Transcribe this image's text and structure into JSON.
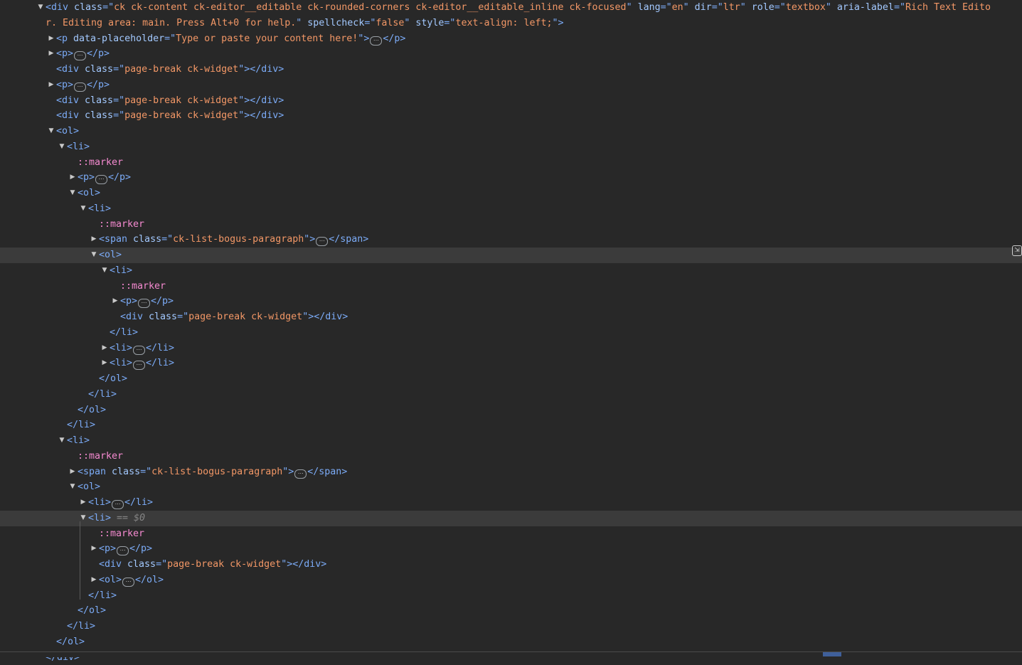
{
  "rows": [
    {
      "indent": 0,
      "toggle": "open",
      "parts": [
        [
          "t",
          "<div "
        ],
        [
          "an",
          "class"
        ],
        [
          "t",
          "=\""
        ],
        [
          "av",
          "ck ck-content ck-editor__editable ck-rounded-corners ck-editor__editable_inline ck-focused"
        ],
        [
          "t",
          "\" "
        ],
        [
          "an",
          "lang"
        ],
        [
          "t",
          "=\""
        ],
        [
          "av",
          "en"
        ],
        [
          "t",
          "\" "
        ],
        [
          "an",
          "dir"
        ],
        [
          "t",
          "=\""
        ],
        [
          "av",
          "ltr"
        ],
        [
          "t",
          "\" "
        ],
        [
          "an",
          "role"
        ],
        [
          "t",
          "=\""
        ],
        [
          "av",
          "textbox"
        ],
        [
          "t",
          "\" "
        ],
        [
          "an",
          "aria-label"
        ],
        [
          "t",
          "=\""
        ],
        [
          "av",
          "Rich Text Edito"
        ]
      ]
    },
    {
      "indent": 0,
      "parts": [
        [
          "av",
          "r. Editing area: main. Press Alt+0 for help."
        ],
        [
          "t",
          "\" "
        ],
        [
          "an",
          "spellcheck"
        ],
        [
          "t",
          "=\""
        ],
        [
          "av",
          "false"
        ],
        [
          "t",
          "\" "
        ],
        [
          "an",
          "style"
        ],
        [
          "t",
          "=\""
        ],
        [
          "av",
          "text-align: left;"
        ],
        [
          "t",
          "\">"
        ]
      ]
    },
    {
      "indent": 1,
      "toggle": "closed",
      "parts": [
        [
          "t",
          "<p "
        ],
        [
          "an",
          "data-placeholder"
        ],
        [
          "t",
          "=\""
        ],
        [
          "av",
          "Type or paste your content here!"
        ],
        [
          "t",
          "\">"
        ],
        [
          "ell",
          "⋯"
        ],
        [
          "t",
          "</p>"
        ]
      ]
    },
    {
      "indent": 1,
      "toggle": "closed",
      "parts": [
        [
          "t",
          "<p>"
        ],
        [
          "ell",
          "⋯"
        ],
        [
          "t",
          "</p>"
        ]
      ]
    },
    {
      "indent": 1,
      "parts": [
        [
          "t",
          "<div "
        ],
        [
          "an",
          "class"
        ],
        [
          "t",
          "=\""
        ],
        [
          "av",
          "page-break ck-widget"
        ],
        [
          "t",
          "\"></div>"
        ]
      ]
    },
    {
      "indent": 1,
      "toggle": "closed",
      "parts": [
        [
          "t",
          "<p>"
        ],
        [
          "ell",
          "⋯"
        ],
        [
          "t",
          "</p>"
        ]
      ]
    },
    {
      "indent": 1,
      "parts": [
        [
          "t",
          "<div "
        ],
        [
          "an",
          "class"
        ],
        [
          "t",
          "=\""
        ],
        [
          "av",
          "page-break ck-widget"
        ],
        [
          "t",
          "\"></div>"
        ]
      ]
    },
    {
      "indent": 1,
      "parts": [
        [
          "t",
          "<div "
        ],
        [
          "an",
          "class"
        ],
        [
          "t",
          "=\""
        ],
        [
          "av",
          "page-break ck-widget"
        ],
        [
          "t",
          "\"></div>"
        ]
      ]
    },
    {
      "indent": 1,
      "toggle": "open",
      "parts": [
        [
          "t",
          "<ol>"
        ]
      ]
    },
    {
      "indent": 2,
      "toggle": "open",
      "parts": [
        [
          "t",
          "<li>"
        ]
      ]
    },
    {
      "indent": 3,
      "parts": [
        [
          "ps",
          "::marker"
        ]
      ]
    },
    {
      "indent": 3,
      "toggle": "closed",
      "parts": [
        [
          "t",
          "<p>"
        ],
        [
          "ell",
          "⋯"
        ],
        [
          "t",
          "</p>"
        ]
      ]
    },
    {
      "indent": 3,
      "toggle": "open",
      "parts": [
        [
          "t",
          "<ol>"
        ]
      ]
    },
    {
      "indent": 4,
      "toggle": "open",
      "parts": [
        [
          "t",
          "<li>"
        ]
      ]
    },
    {
      "indent": 5,
      "parts": [
        [
          "ps",
          "::marker"
        ]
      ]
    },
    {
      "indent": 5,
      "toggle": "closed",
      "parts": [
        [
          "t",
          "<span "
        ],
        [
          "an",
          "class"
        ],
        [
          "t",
          "=\""
        ],
        [
          "av",
          "ck-list-bogus-paragraph"
        ],
        [
          "t",
          "\">"
        ],
        [
          "ell",
          "⋯"
        ],
        [
          "t",
          "</span>"
        ]
      ]
    },
    {
      "indent": 5,
      "toggle": "open",
      "selected": true,
      "parts": [
        [
          "t",
          "<ol>"
        ]
      ]
    },
    {
      "indent": 6,
      "toggle": "open",
      "parts": [
        [
          "t",
          "<li>"
        ]
      ]
    },
    {
      "indent": 7,
      "parts": [
        [
          "ps",
          "::marker"
        ]
      ]
    },
    {
      "indent": 7,
      "toggle": "closed",
      "parts": [
        [
          "t",
          "<p>"
        ],
        [
          "ell",
          "⋯"
        ],
        [
          "t",
          "</p>"
        ]
      ]
    },
    {
      "indent": 7,
      "parts": [
        [
          "t",
          "<div "
        ],
        [
          "an",
          "class"
        ],
        [
          "t",
          "=\""
        ],
        [
          "av",
          "page-break ck-widget"
        ],
        [
          "t",
          "\"></div>"
        ]
      ]
    },
    {
      "indent": 6,
      "parts": [
        [
          "t",
          "</li>"
        ]
      ]
    },
    {
      "indent": 6,
      "toggle": "closed",
      "parts": [
        [
          "t",
          "<li>"
        ],
        [
          "ell",
          "⋯"
        ],
        [
          "t",
          "</li>"
        ]
      ]
    },
    {
      "indent": 6,
      "toggle": "closed",
      "parts": [
        [
          "t",
          "<li>"
        ],
        [
          "ell",
          "⋯"
        ],
        [
          "t",
          "</li>"
        ]
      ]
    },
    {
      "indent": 5,
      "parts": [
        [
          "t",
          "</ol>"
        ]
      ]
    },
    {
      "indent": 4,
      "parts": [
        [
          "t",
          "</li>"
        ]
      ]
    },
    {
      "indent": 3,
      "parts": [
        [
          "t",
          "</ol>"
        ]
      ]
    },
    {
      "indent": 2,
      "parts": [
        [
          "t",
          "</li>"
        ]
      ]
    },
    {
      "indent": 2,
      "toggle": "open",
      "parts": [
        [
          "t",
          "<li>"
        ]
      ]
    },
    {
      "indent": 3,
      "parts": [
        [
          "ps",
          "::marker"
        ]
      ]
    },
    {
      "indent": 3,
      "toggle": "closed",
      "parts": [
        [
          "t",
          "<span "
        ],
        [
          "an",
          "class"
        ],
        [
          "t",
          "=\""
        ],
        [
          "av",
          "ck-list-bogus-paragraph"
        ],
        [
          "t",
          "\">"
        ],
        [
          "ell",
          "⋯"
        ],
        [
          "t",
          "</span>"
        ]
      ]
    },
    {
      "indent": 3,
      "toggle": "open",
      "parts": [
        [
          "t",
          "<ol>"
        ]
      ]
    },
    {
      "indent": 4,
      "toggle": "closed",
      "parts": [
        [
          "t",
          "<li>"
        ],
        [
          "ell",
          "⋯"
        ],
        [
          "t",
          "</li>"
        ]
      ]
    },
    {
      "indent": 4,
      "toggle": "open",
      "selected": true,
      "parts": [
        [
          "t",
          "<li>"
        ],
        [
          "eq",
          " == $0"
        ]
      ]
    },
    {
      "indent": 5,
      "parts": [
        [
          "ps",
          "::marker"
        ]
      ]
    },
    {
      "indent": 5,
      "toggle": "closed",
      "parts": [
        [
          "t",
          "<p>"
        ],
        [
          "ell",
          "⋯"
        ],
        [
          "t",
          "</p>"
        ]
      ]
    },
    {
      "indent": 5,
      "parts": [
        [
          "t",
          "<div "
        ],
        [
          "an",
          "class"
        ],
        [
          "t",
          "=\""
        ],
        [
          "av",
          "page-break ck-widget"
        ],
        [
          "t",
          "\"></div>"
        ]
      ]
    },
    {
      "indent": 5,
      "toggle": "closed",
      "parts": [
        [
          "t",
          "<ol>"
        ],
        [
          "ell",
          "⋯"
        ],
        [
          "t",
          "</ol>"
        ]
      ]
    },
    {
      "indent": 4,
      "parts": [
        [
          "t",
          "</li>"
        ]
      ]
    },
    {
      "indent": 3,
      "parts": [
        [
          "t",
          "</ol>"
        ]
      ]
    },
    {
      "indent": 2,
      "parts": [
        [
          "t",
          "</li>"
        ]
      ]
    },
    {
      "indent": 1,
      "parts": [
        [
          "t",
          "</ol>"
        ]
      ]
    },
    {
      "indent": 0,
      "parts": [
        [
          "t",
          "</div>"
        ]
      ]
    }
  ],
  "icons": {
    "side_icon": "screenshot-node-icon"
  }
}
